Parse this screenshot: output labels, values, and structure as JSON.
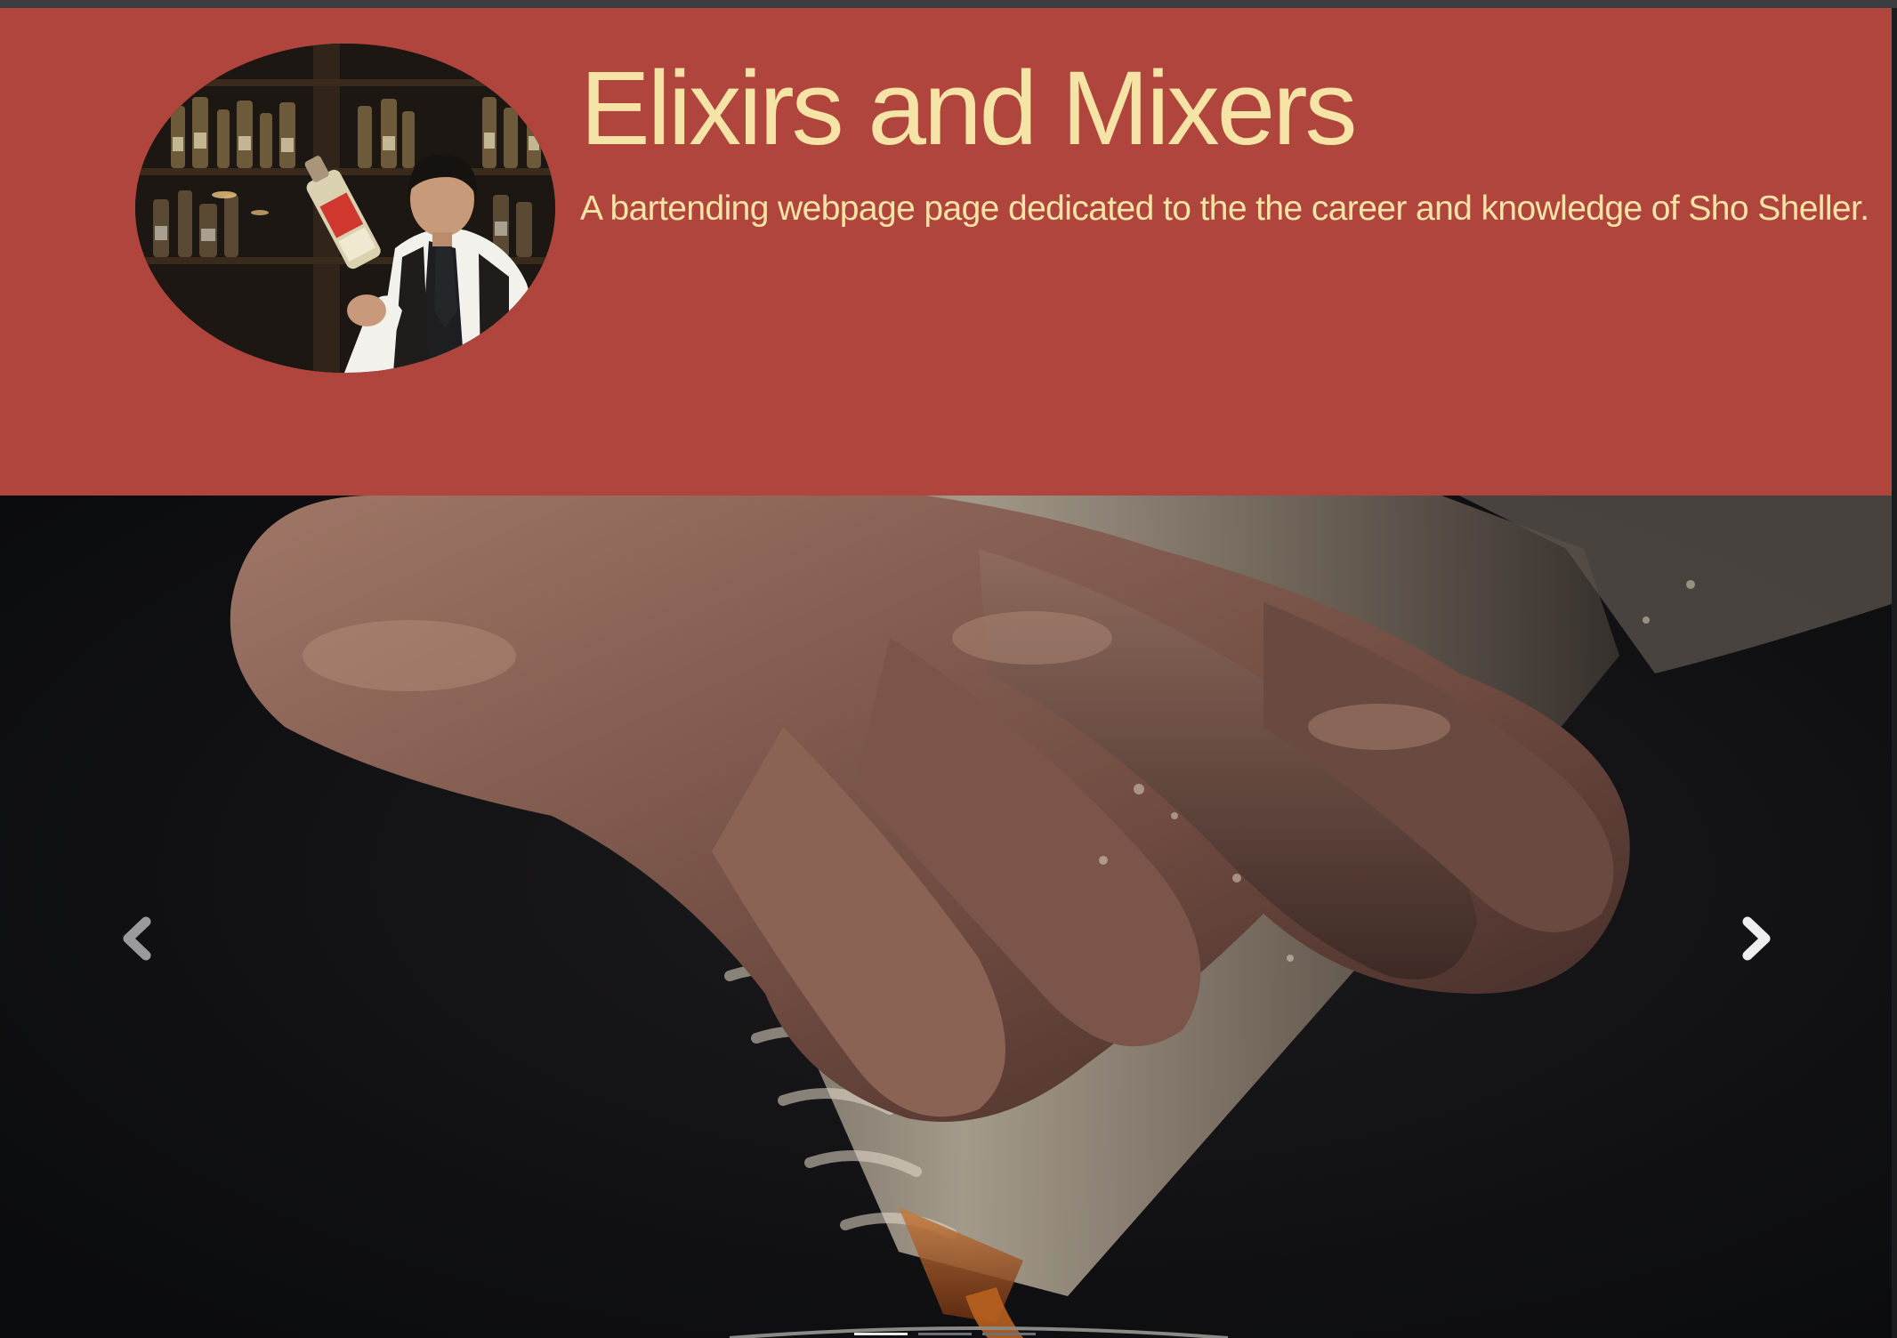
{
  "header": {
    "title": "Elixirs and Mixers",
    "tagline": "A bartending webpage page dedicated to the the career and knowledge of Sho Sheller.",
    "background_color": "#b0453d",
    "text_color": "#f6e3a6",
    "avatar_icon": "bartender-photo"
  },
  "carousel": {
    "slide_image": "pouring-drink-photo",
    "prev_icon": "chevron-left-icon",
    "next_icon": "chevron-right-icon",
    "indicators": [
      {
        "active": true
      },
      {
        "active": false
      },
      {
        "active": false
      }
    ]
  }
}
